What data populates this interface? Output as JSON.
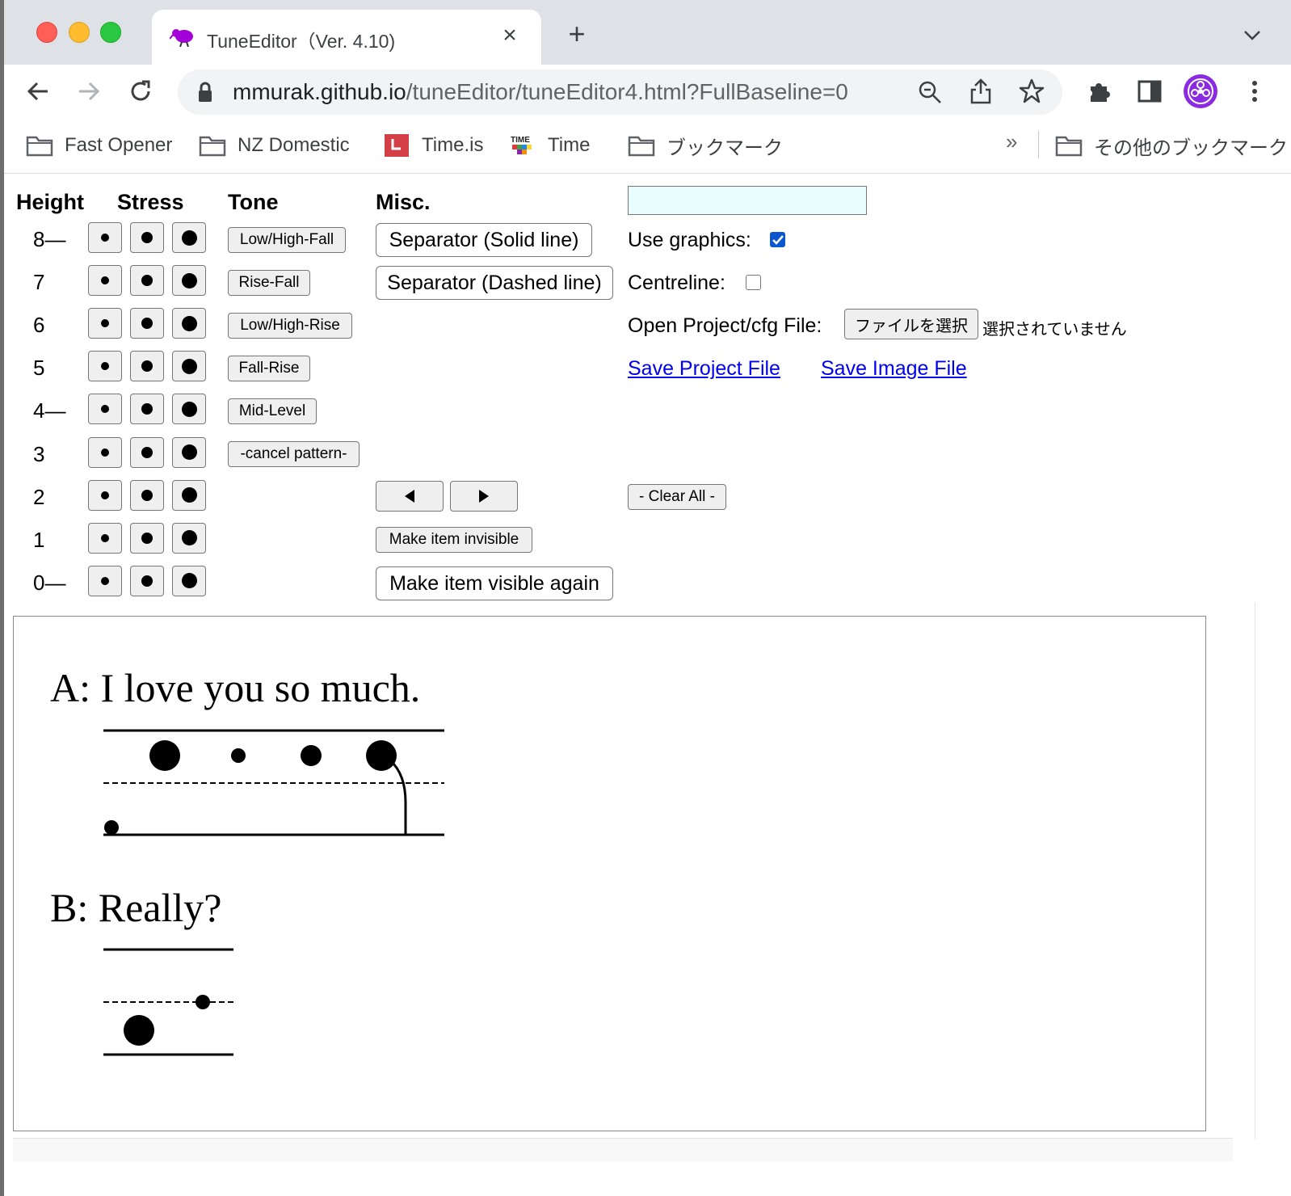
{
  "browser": {
    "tab_title": "TuneEditor（Ver. 4.10)",
    "tab_close": "×",
    "new_tab": "+",
    "url_host": "mmurak.github.io",
    "url_path": "/tuneEditor/tuneEditor4.html?FullBaseline=0"
  },
  "bookmarks": {
    "items": [
      {
        "label": "Fast Opener",
        "icon": "folder-icon"
      },
      {
        "label": "NZ Domestic",
        "icon": "folder-icon"
      },
      {
        "label": "Time.is",
        "icon": "timeis-icon"
      },
      {
        "label": "Time",
        "icon": "time-icon"
      },
      {
        "label": "ブックマーク",
        "icon": "folder-icon"
      }
    ],
    "overflow": "»",
    "other": "その他のブックマーク"
  },
  "headers": {
    "height": "Height",
    "stress": "Stress",
    "tone": "Tone",
    "misc": "Misc."
  },
  "heights": [
    "8—",
    "7",
    "6",
    "5",
    "4—",
    "3",
    "2",
    "1",
    "0—"
  ],
  "tone_buttons": [
    "Low/High-Fall",
    "Rise-Fall",
    "Low/High-Rise",
    "Fall-Rise",
    "Mid-Level",
    "-cancel pattern-"
  ],
  "misc": {
    "separator_solid": "Separator (Solid line)",
    "separator_dashed": "Separator (Dashed line)",
    "prev_arrow": "◀",
    "next_arrow": "▶",
    "make_invisible": "Make item invisible",
    "make_visible": "Make item visible again"
  },
  "settings": {
    "text_input_value": "",
    "use_graphics_label": "Use graphics:",
    "use_graphics_checked": true,
    "centreline_label": "Centreline:",
    "centreline_checked": false,
    "open_file_label": "Open Project/cfg File:",
    "choose_file_button": "ファイルを選択",
    "file_status": "選択されていません",
    "save_project": "Save Project File",
    "save_image": "Save Image File",
    "clear_all": "- Clear All -"
  },
  "canvas": {
    "line_a": "A: I love you so much.",
    "line_b": "B: Really?"
  }
}
